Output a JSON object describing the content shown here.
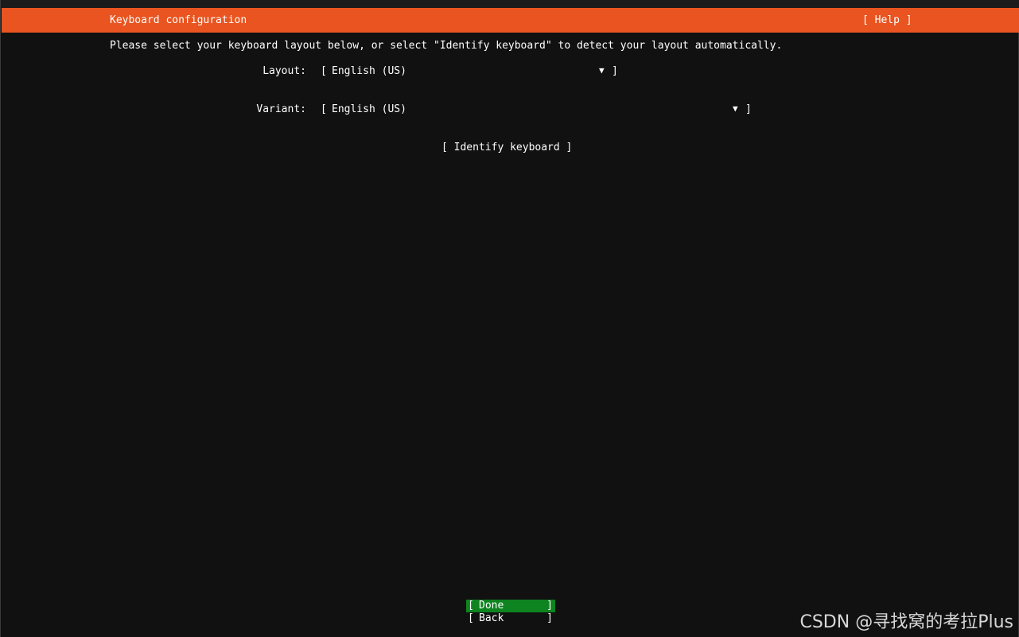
{
  "header": {
    "title": "Keyboard configuration",
    "help_label": "[ Help ]",
    "color": "#e95420"
  },
  "instructions": "Please select your keyboard layout below, or select \"Identify keyboard\" to detect your layout automatically.",
  "layout": {
    "label": "Layout:",
    "value": "English (US)",
    "arrow": "▼"
  },
  "variant": {
    "label": "Variant:",
    "value": "English (US)",
    "arrow": "▼"
  },
  "identify_button": "[ Identify keyboard ]",
  "buttons": {
    "done": "Done",
    "back": "Back",
    "done_color": "#0e8420"
  },
  "watermark": "CSDN @寻找窝的考拉Plus"
}
